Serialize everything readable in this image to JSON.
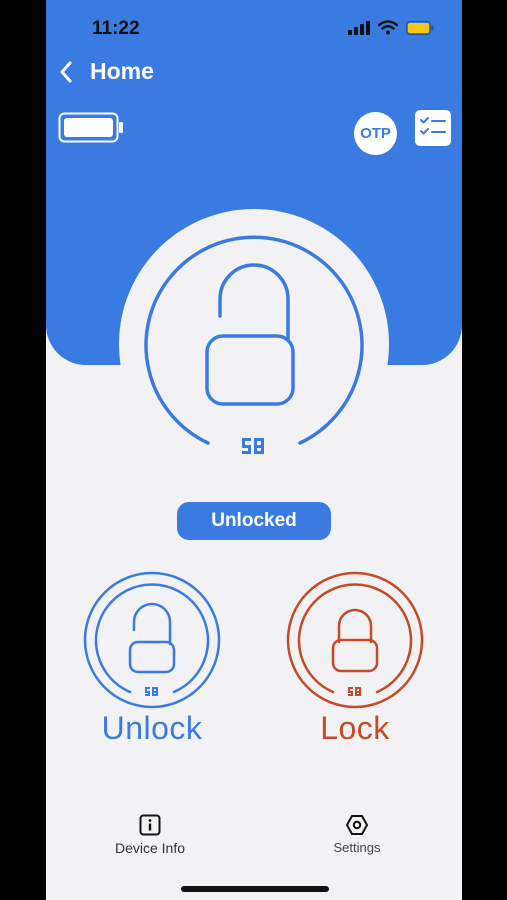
{
  "status_bar": {
    "time": "11:22"
  },
  "nav": {
    "back_label": "Home"
  },
  "toolbar": {
    "otp_label": "OTP"
  },
  "lock_state": {
    "status_label": "Unlocked"
  },
  "actions": {
    "unlock_label": "Unlock",
    "lock_label": "Lock"
  },
  "tabbar": {
    "device_info_label": "Device Info",
    "settings_label": "Settings"
  },
  "colors": {
    "primary": "#3a7be2",
    "lock": "#c74a26",
    "background": "#f2f2f4"
  }
}
